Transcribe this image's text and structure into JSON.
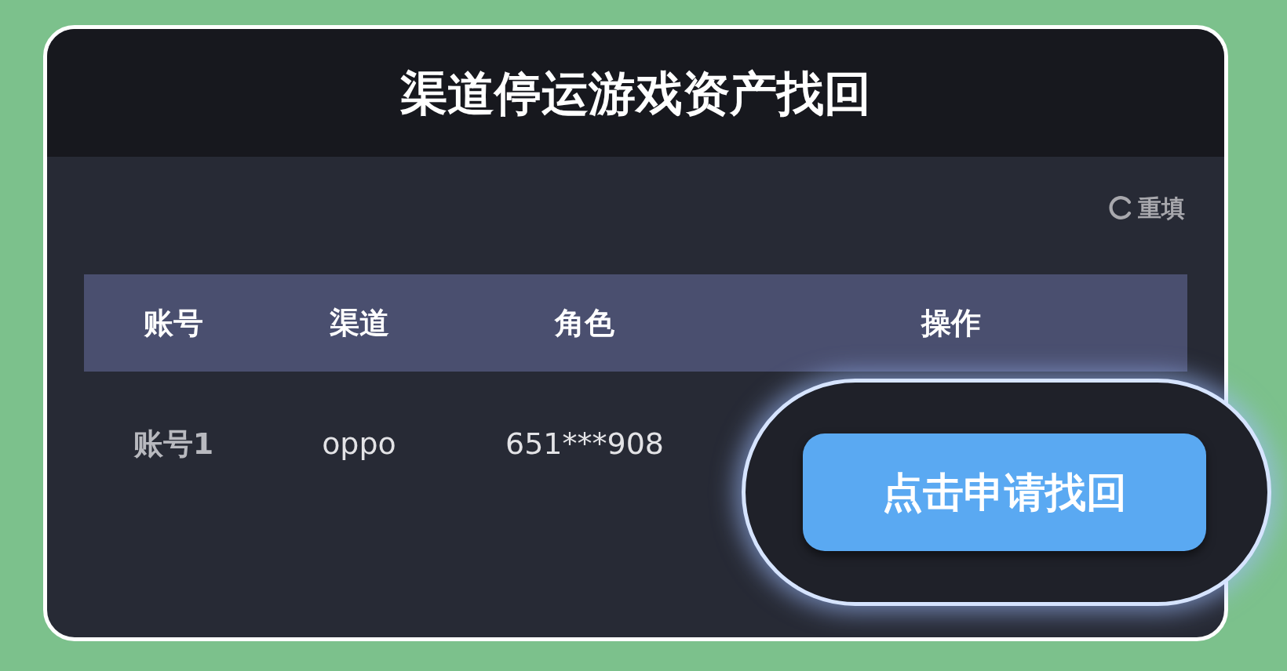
{
  "title": "渠道停运游戏资产找回",
  "reset_button": {
    "label": "重填"
  },
  "table": {
    "columns": [
      "账号",
      "渠道",
      "角色",
      "操作"
    ],
    "rows": [
      {
        "account": "账号1",
        "channel": "oppo",
        "role": "651***908",
        "action": "点击申请找回"
      }
    ]
  }
}
